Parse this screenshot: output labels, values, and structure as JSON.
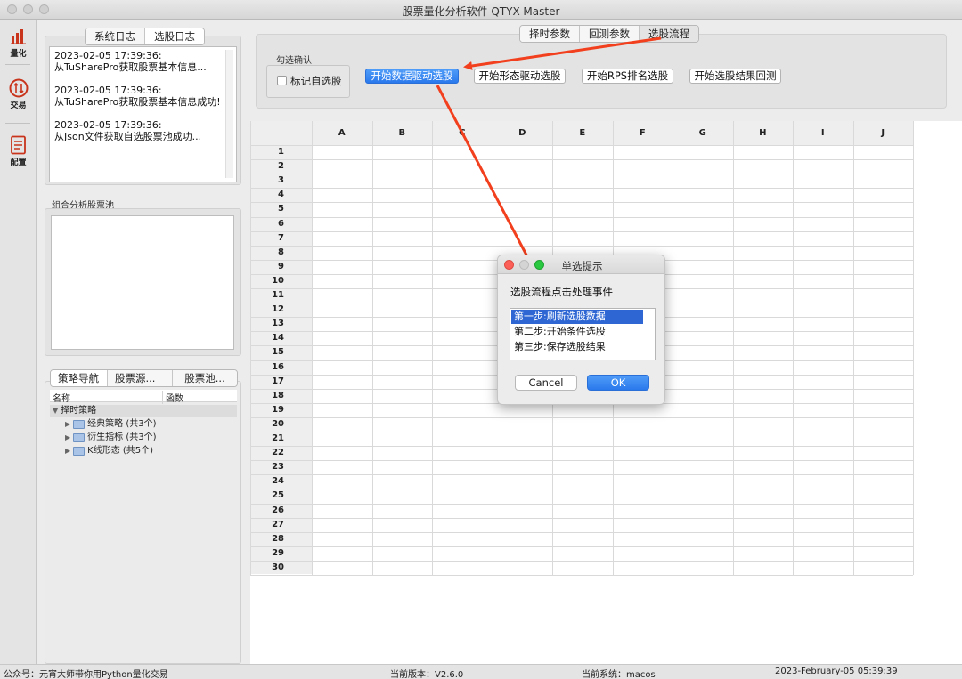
{
  "window": {
    "title": "股票量化分析软件 QTYX-Master"
  },
  "nav": [
    {
      "label": "量化",
      "icon": "bar-chart-icon"
    },
    {
      "label": "交易",
      "icon": "trade-icon"
    },
    {
      "label": "配置",
      "icon": "config-icon"
    }
  ],
  "log_tabs": [
    "系统日志",
    "选股日志"
  ],
  "logs": [
    {
      "time": "2023-02-05 17:39:36:",
      "msg": "从TuSharePro获取股票基本信息..."
    },
    {
      "time": "2023-02-05 17:39:36:",
      "msg": "从TuSharePro获取股票基本信息成功!"
    },
    {
      "time": "2023-02-05 17:39:36:",
      "msg": "从Json文件获取自选股票池成功..."
    }
  ],
  "pool": {
    "label": "组合分析股票池"
  },
  "strategy_tabs": [
    "策略导航",
    "股票源...",
    "股票池..."
  ],
  "tree": {
    "col_name": "名称",
    "col_func": "函数",
    "root": "择时策略",
    "children": [
      "经典策略 (共3个)",
      "衍生指标 (共3个)",
      "K线形态 (共5个)"
    ]
  },
  "top_tabs": [
    "择时参数",
    "回测参数",
    "选股流程"
  ],
  "confirm": {
    "group_label": "勾选确认",
    "checkbox_label": "标记自选股"
  },
  "buttons": [
    "开始数据驱动选股",
    "开始形态驱动选股",
    "开始RPS排名选股",
    "开始选股结果回测"
  ],
  "grid": {
    "columns": [
      "A",
      "B",
      "C",
      "D",
      "E",
      "F",
      "G",
      "H",
      "I",
      "J"
    ],
    "rows": [
      "1",
      "2",
      "3",
      "4",
      "5",
      "6",
      "7",
      "8",
      "9",
      "10",
      "11",
      "12",
      "13",
      "14",
      "15",
      "16",
      "17",
      "18",
      "19",
      "20",
      "21",
      "22",
      "23",
      "24",
      "25",
      "26",
      "27",
      "28",
      "29",
      "30"
    ]
  },
  "dialog": {
    "title": "单选提示",
    "prompt": "选股流程点击处理事件",
    "options": [
      "第一步:刷新选股数据",
      "第二步:开始条件选股",
      "第三步:保存选股结果"
    ],
    "cancel": "Cancel",
    "ok": "OK"
  },
  "status": {
    "account": "公众号：元宵大师带你用Python量化交易",
    "version": "当前版本：V2.6.0",
    "system": "当前系统：macos",
    "datetime": "2023-February-05 05:39:39"
  },
  "colors": {
    "accent": "#2a79ec",
    "arrow": "#f2401e",
    "selection": "#2e67d4"
  }
}
